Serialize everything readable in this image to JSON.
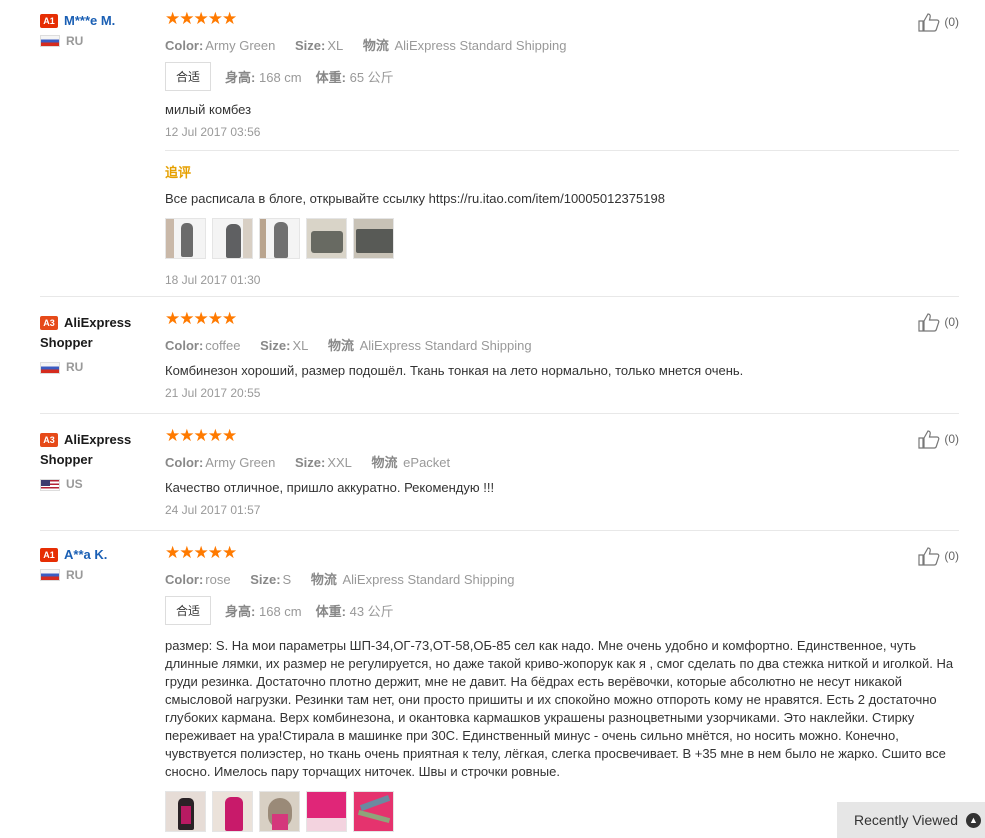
{
  "reviews": [
    {
      "level": "A1",
      "name": "M***e M.",
      "country": "RU",
      "meta": [
        {
          "key": "Color:",
          "val": "Army Green"
        },
        {
          "key": "Size:",
          "val": "XL"
        },
        {
          "key": "物流",
          "val": "AliExpress Standard Shipping"
        }
      ],
      "fit": {
        "tag": "合适",
        "height_key": "身高:",
        "height_val": "168 cm",
        "weight_key": "体重:",
        "weight_val": "65 公斤"
      },
      "text": "милый комбез",
      "date": "12 Jul 2017 03:56",
      "follow": {
        "label": "追评",
        "text": "Все расписала в блоге, открывайте ссылку https://ru.itao.com/item/10005012375198",
        "date": "18 Jul 2017 01:30"
      },
      "likes": "(0)"
    },
    {
      "level": "A3",
      "name": "AliExpress Shopper",
      "country": "RU",
      "meta": [
        {
          "key": "Color:",
          "val": "coffee"
        },
        {
          "key": "Size:",
          "val": "XL"
        },
        {
          "key": "物流",
          "val": "AliExpress Standard Shipping"
        }
      ],
      "text": "Комбинезон хороший, размер подошёл. Ткань тонкая на лето нормально, только мнется очень.",
      "date": "21 Jul 2017 20:55",
      "likes": "(0)"
    },
    {
      "level": "A3",
      "name": "AliExpress Shopper",
      "country": "US",
      "meta": [
        {
          "key": "Color:",
          "val": "Army Green"
        },
        {
          "key": "Size:",
          "val": "XXL"
        },
        {
          "key": "物流",
          "val": "ePacket"
        }
      ],
      "text": "Качество отличное, пришло аккуратно. Рекомендую !!!",
      "date": "24 Jul 2017 01:57",
      "likes": "(0)"
    },
    {
      "level": "A1",
      "name": "A**a K.",
      "country": "RU",
      "meta": [
        {
          "key": "Color:",
          "val": "rose"
        },
        {
          "key": "Size:",
          "val": "S"
        },
        {
          "key": "物流",
          "val": "AliExpress Standard Shipping"
        }
      ],
      "fit": {
        "tag": "合适",
        "height_key": "身高:",
        "height_val": "168 cm",
        "weight_key": "体重:",
        "weight_val": "43 公斤"
      },
      "text": "размер: S. На мои параметры ШП-34,ОГ-73,ОТ-58,ОБ-85 сел как надо. Мне очень удобно и комфортно. Единственное, чуть длинные лямки, их размер не регулируется, но даже такой криво-жопорук как я , смог сделать по два стежка ниткой и иголкой. На груди резинка. Достаточно плотно держит, мне не давит. На бёдрах есть верёвочки, которые абсолютно не несут никакой смысловой нагрузки. Резинки там нет, они просто пришиты и их спокойно можно отпороть кому не нравятся. Есть 2 достаточно глубоких кармана. Верх комбинезона, и окантовка кармашков украшены разноцветными узорчиками. Это наклейки. Стирку переживает на ура!Стирала в машинке при 30С. Единственный минус - очень сильно мнётся, но носить можно. Конечно, чувствуется полиэстер, но ткань очень приятная к телу, лёгкая, слегка просвечивает. В +35 мне в нем было не жарко. Сшито все сносно. Имелось пару торчащих ниточек. Швы и строчки ровные.",
      "likes": "(0)"
    }
  ],
  "recently_viewed": "Recently Viewed",
  "colors": {
    "stars": "#ff7a00",
    "level_a1": "#e62e04",
    "follow_label": "#e6a000",
    "username": "#1a5fb4"
  }
}
